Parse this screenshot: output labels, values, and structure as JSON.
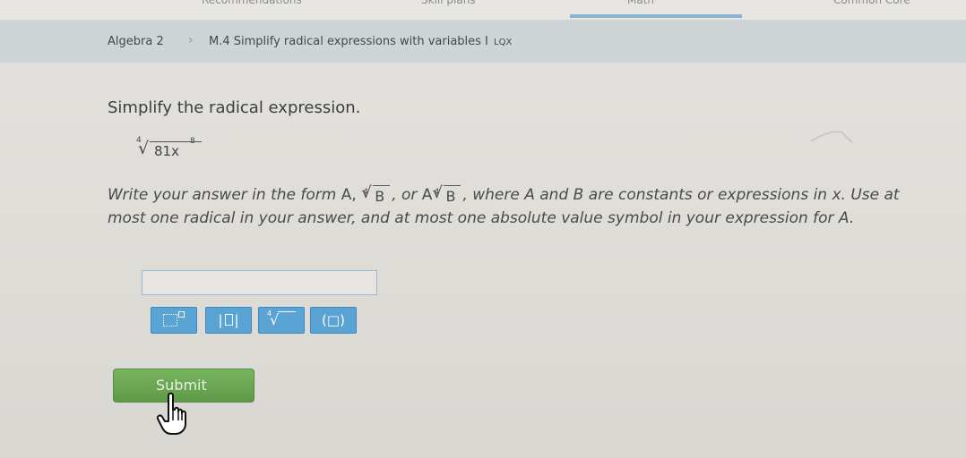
{
  "topnav": {
    "items": [
      "Recommendations",
      "Skill plans",
      "Math",
      "Common Core"
    ]
  },
  "breadcrumb": {
    "subject": "Algebra 2",
    "skill": "M.4 Simplify radical expressions with variables I",
    "code": "LQX"
  },
  "question": {
    "prompt": "Simplify the radical expression.",
    "radical": {
      "index": "4",
      "radicand": "81x",
      "exponent": "8"
    },
    "instr_part1": "Write your answer in the form ",
    "form_a": "A,",
    "index_label": "4",
    "form_b_label": "B",
    "instr_part2": ", or ",
    "form_ab_a": "A",
    "instr_part3": ", where A and B are constants or expressions in x. Use at most one radical in your answer, and at most one absolute value symbol in your expression for A."
  },
  "answer": {
    "value": "",
    "placeholder": ""
  },
  "toolbar": {
    "exponent_icon": "exponent-icon",
    "abs_icon": "absolute-value-icon",
    "root_icon": "nth-root-icon",
    "paren_icon": "parentheses-icon",
    "paren_label": "(□)"
  },
  "submit": {
    "label": "Submit"
  },
  "colors": {
    "toolbar_button": "#5aa3d5",
    "submit_button": "#6aa653",
    "nav_active": "#8fb3d1",
    "breadcrumb_bar": "#cfd5d6"
  }
}
